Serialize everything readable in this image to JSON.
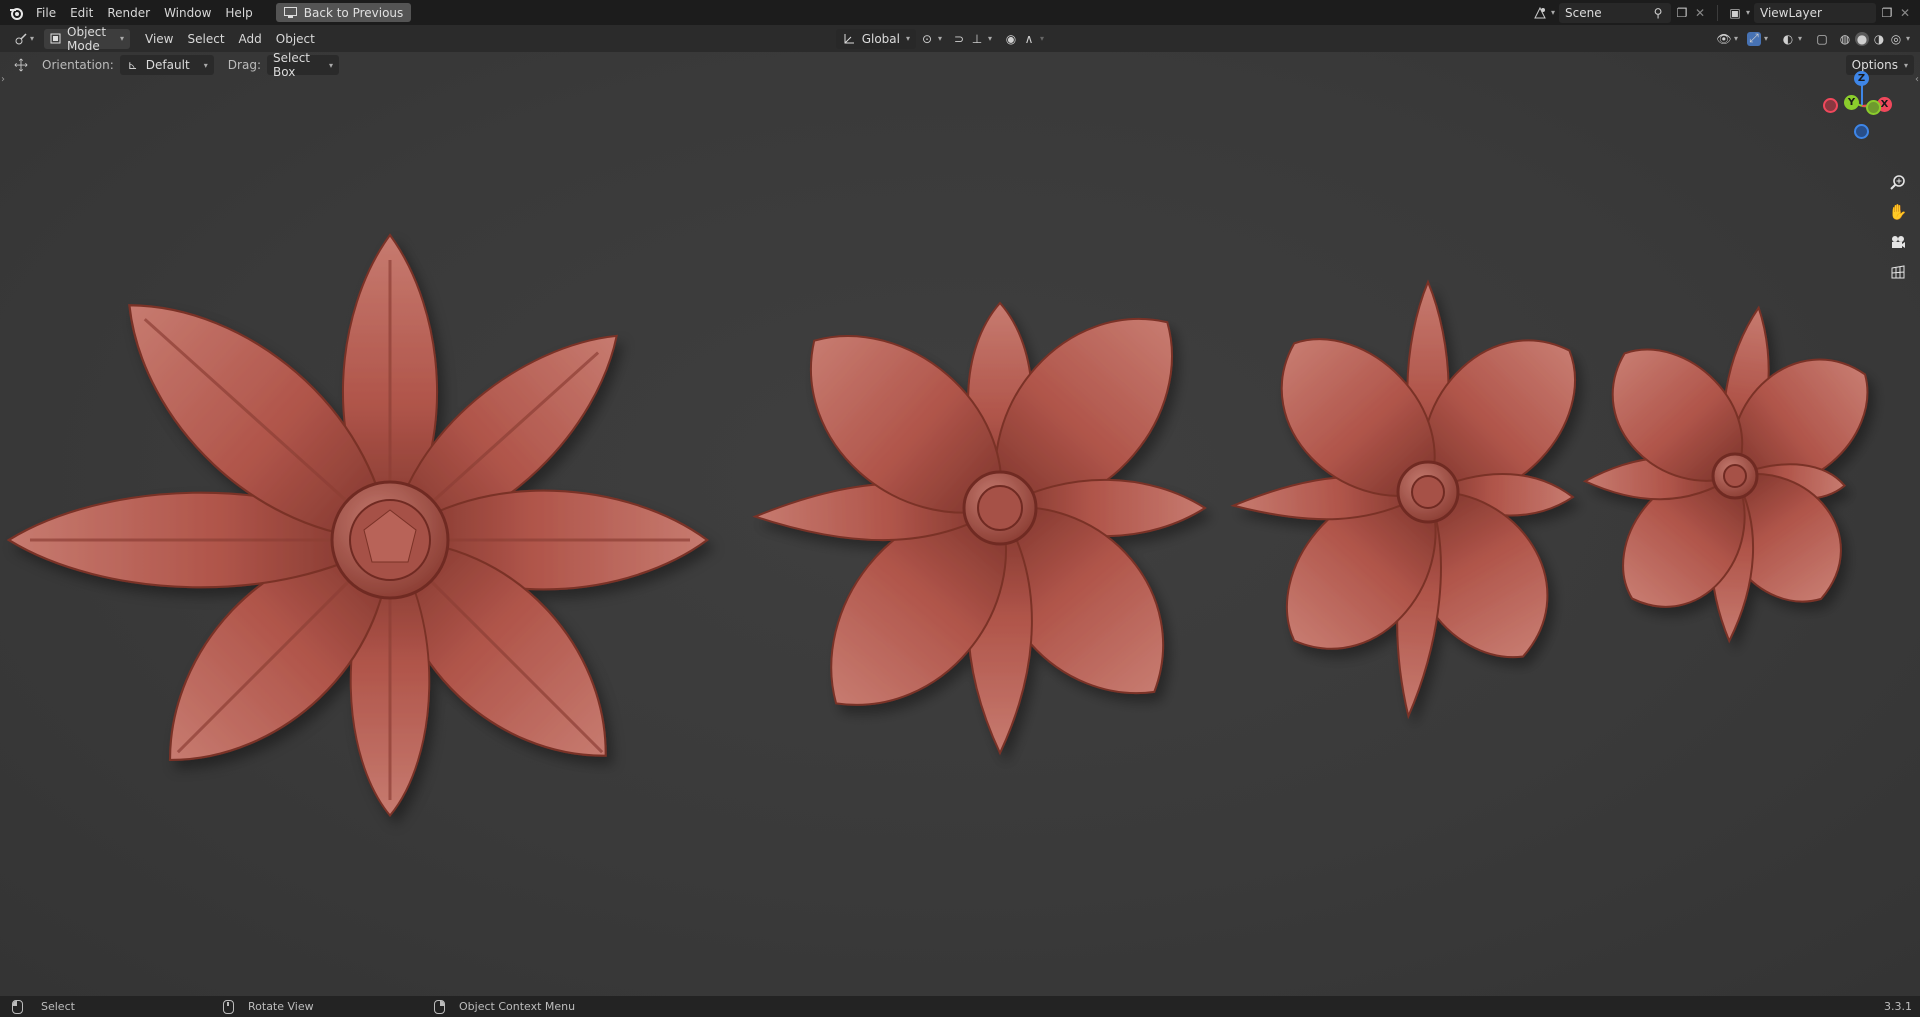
{
  "topbar": {
    "menus": [
      "File",
      "Edit",
      "Render",
      "Window",
      "Help"
    ],
    "back_button": "Back to Previous",
    "scene": "Scene",
    "view_layer": "ViewLayer"
  },
  "header": {
    "mode": "Object Mode",
    "menus": [
      "View",
      "Select",
      "Add",
      "Object"
    ],
    "transform_orientation": "Global"
  },
  "tool_header": {
    "orientation_label": "Orientation:",
    "orientation_value": "Default",
    "drag_label": "Drag:",
    "drag_value": "Select Box",
    "options": "Options"
  },
  "gizmo": {
    "z": "Z",
    "y": "Y",
    "x": "X"
  },
  "statusbar": {
    "select": "Select",
    "rotate": "Rotate View",
    "context": "Object Context Menu",
    "version": "3.3.1"
  },
  "colors": {
    "flower": "#b5594f",
    "viewport_bg": "#3a3a3a",
    "accent_blue": "#4772b3",
    "axis_x": "#f0485c",
    "axis_y": "#8bcd2c",
    "axis_z": "#3e86e8"
  },
  "icons": [
    "blender-logo-icon",
    "editor-type-icon",
    "object-mode-icon",
    "move-tool-icon",
    "zoom-icon",
    "hand-icon",
    "camera-icon",
    "grid-icon",
    "mouse-left-icon",
    "mouse-middle-icon",
    "mouse-right-icon"
  ]
}
